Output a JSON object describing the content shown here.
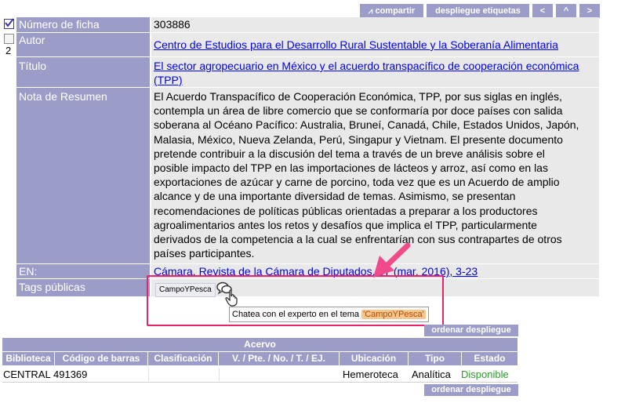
{
  "toolbar": {
    "share": "compartir",
    "labels": "despliegue etiquetas",
    "prev": "<",
    "up": "^",
    "next": ">"
  },
  "record": {
    "row_number": "2",
    "fields": {
      "ficha_label": "Número de ficha",
      "ficha_value": "303886",
      "autor_label": "Autor",
      "autor_value": "Centro de Estudios para el Desarrollo Rural Sustentable y la Soberanía Alimentaria",
      "titulo_label": "Título",
      "titulo_value": "El sector agropecuario en México y el acuerdo transpacífico de cooperación económica (TPP)",
      "resumen_label": "Nota de Resumen",
      "resumen_lines": [
        "El Acuerdo Transpacífico de Cooperación Económica, TPP, por sus siglas en inglés,",
        "contempla un área de libre comercio que se conformaría por doce países con salida",
        "soberana al Océano Pacífico: Australia, Bruneí, Canadá, Chile, Estados Unidos, Japón,",
        "Malasia, México, Nueva Zelanda, Perú, Singapur y Vietnam. El presente documento",
        "pretende contribuir a la discusión del tema a través de un breve análisis sobre el",
        "posible impacto del TPP en las importaciones de lácteos y arroz, así como en las",
        "exportaciones de azúcar y carne de porcino, toda vez que es un Acuerdo de amplio",
        "alcance y de una importante diversidad de temas. Asimismo, se presentan",
        "recomendaciones de políticas públicas orientadas a preparar a los productores",
        "agroalimentarios antes los retos y desafíos que implica el TPP, particularmente",
        "derivados de la competencia a la cual se enfrentarían con sus contrapartes de otros",
        "países participantes."
      ],
      "en_label": "EN:",
      "en_value": "Cámara. Revista de la Cámara de Diputados. 57 (mar. 2016), 3-23",
      "tags_label": "Tags públicas",
      "tag": "CampoYPesca",
      "tooltip_prefix": "Chatea con el experto en el tema",
      "tooltip_tag": "'CampoYPesca'"
    }
  },
  "order_button": "ordenar despliegue",
  "acervo": {
    "title": "Acervo",
    "headers": [
      "Biblioteca",
      "Código de barras",
      "Clasificación",
      "V. / Pte. / No. / T. / EJ.",
      "Ubicación",
      "Tipo",
      "Estado"
    ],
    "row": {
      "biblioteca": "CENTRAL",
      "codigo": "491369",
      "clasificacion": "",
      "volumen": "",
      "ubicacion": "Hemeroteca",
      "tipo": "Analítica",
      "estado": "Disponible"
    }
  },
  "colors": {
    "accent": "#9c9cc9",
    "value_bg": "#e9e9e9",
    "link": "#0000ee",
    "highlight_box": "#e8246a",
    "arrow": "#f04a8a",
    "available": "#2a9d2a"
  }
}
